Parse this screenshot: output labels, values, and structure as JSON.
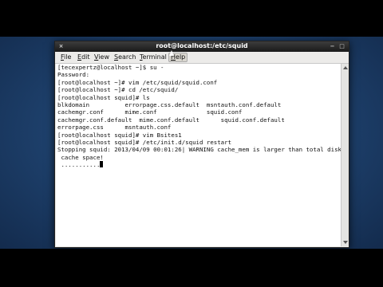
{
  "window": {
    "title": "root@localhost:/etc/squid",
    "close_glyph": "×",
    "minimize_glyph": "−",
    "maximize_glyph": "□"
  },
  "menu": {
    "items": [
      {
        "mnemonic": "F",
        "rest": "ile"
      },
      {
        "mnemonic": "E",
        "rest": "dit"
      },
      {
        "mnemonic": "V",
        "rest": "iew"
      },
      {
        "mnemonic": "S",
        "rest": "earch"
      },
      {
        "mnemonic": "T",
        "rest": "erminal"
      },
      {
        "mnemonic": "H",
        "rest": "elp"
      }
    ]
  },
  "terminal": {
    "lines": [
      "[tecexpertz@localhost ~]$ su -",
      "Password:",
      "[root@localhost ~]# vim /etc/squid/squid.conf",
      "[root@localhost ~]# cd /etc/squid/",
      "[root@localhost squid]# ls",
      "blkdomain          errorpage.css.default  msntauth.conf.default",
      "cachemgr.conf      mime.conf              squid.conf",
      "cachemgr.conf.default  mime.conf.default      squid.conf.default",
      "errorpage.css      msntauth.conf",
      "[root@localhost squid]# vim Bsites1",
      "[root@localhost squid]# /etc/init.d/squid restart",
      "Stopping squid: 2013/04/09 00:01:26| WARNING cache_mem is larger than total disk",
      " cache space!",
      " ..........."
    ]
  }
}
